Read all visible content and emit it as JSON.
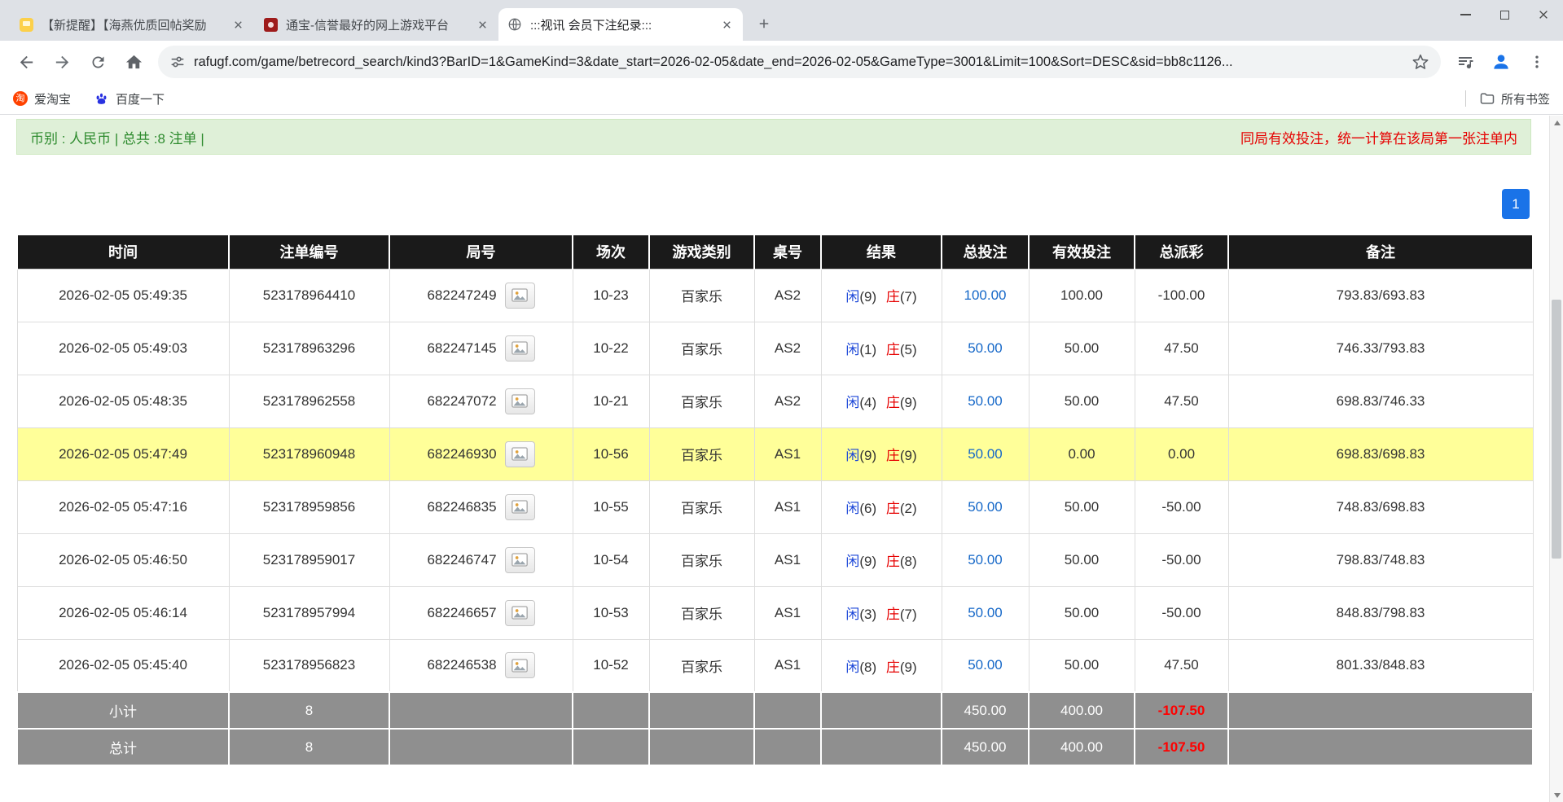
{
  "browser": {
    "tabs": [
      {
        "title": "【新提醒】【海燕优质回帖奖励"
      },
      {
        "title": "通宝-信誉最好的网上游戏平台"
      },
      {
        "title": ":::视讯 会员下注纪录:::"
      }
    ],
    "url": "rafugf.com/game/betrecord_search/kind3?BarID=1&GameKind=3&date_start=2026-02-05&date_end=2026-02-05&GameType=3001&Limit=100&Sort=DESC&sid=bb8c1126...",
    "bookmarks": [
      {
        "label": "爱淘宝"
      },
      {
        "label": "百度一下"
      }
    ],
    "all_bookmarks_label": "所有书签"
  },
  "page": {
    "summary_text": "币别 : 人民币 | 总共 :8 注单 |",
    "notice_text": "同局有效投注，统一计算在该局第一张注单内",
    "pagination": {
      "current": "1"
    }
  },
  "table": {
    "headers": [
      "时间",
      "注单编号",
      "局号",
      "场次",
      "游戏类别",
      "桌号",
      "结果",
      "总投注",
      "有效投注",
      "总派彩",
      "备注"
    ],
    "rows": [
      {
        "time": "2026-02-05 05:49:35",
        "bet_id": "523178964410",
        "round": "682247249",
        "session": "10-23",
        "game": "百家乐",
        "table_no": "AS2",
        "player": "闲(9)",
        "banker": "庄(7)",
        "total_bet": "100.00",
        "valid_bet": "100.00",
        "payout": "-100.00",
        "note": "793.83/693.83",
        "highlight": false
      },
      {
        "time": "2026-02-05 05:49:03",
        "bet_id": "523178963296",
        "round": "682247145",
        "session": "10-22",
        "game": "百家乐",
        "table_no": "AS2",
        "player": "闲(1)",
        "banker": "庄(5)",
        "total_bet": "50.00",
        "valid_bet": "50.00",
        "payout": "47.50",
        "note": "746.33/793.83",
        "highlight": false
      },
      {
        "time": "2026-02-05 05:48:35",
        "bet_id": "523178962558",
        "round": "682247072",
        "session": "10-21",
        "game": "百家乐",
        "table_no": "AS2",
        "player": "闲(4)",
        "banker": "庄(9)",
        "total_bet": "50.00",
        "valid_bet": "50.00",
        "payout": "47.50",
        "note": "698.83/746.33",
        "highlight": false
      },
      {
        "time": "2026-02-05 05:47:49",
        "bet_id": "523178960948",
        "round": "682246930",
        "session": "10-56",
        "game": "百家乐",
        "table_no": "AS1",
        "player": "闲(9)",
        "banker": "庄(9)",
        "total_bet": "50.00",
        "valid_bet": "0.00",
        "payout": "0.00",
        "note": "698.83/698.83",
        "highlight": true
      },
      {
        "time": "2026-02-05 05:47:16",
        "bet_id": "523178959856",
        "round": "682246835",
        "session": "10-55",
        "game": "百家乐",
        "table_no": "AS1",
        "player": "闲(6)",
        "banker": "庄(2)",
        "total_bet": "50.00",
        "valid_bet": "50.00",
        "payout": "-50.00",
        "note": "748.83/698.83",
        "highlight": false
      },
      {
        "time": "2026-02-05 05:46:50",
        "bet_id": "523178959017",
        "round": "682246747",
        "session": "10-54",
        "game": "百家乐",
        "table_no": "AS1",
        "player": "闲(9)",
        "banker": "庄(8)",
        "total_bet": "50.00",
        "valid_bet": "50.00",
        "payout": "-50.00",
        "note": "798.83/748.83",
        "highlight": false
      },
      {
        "time": "2026-02-05 05:46:14",
        "bet_id": "523178957994",
        "round": "682246657",
        "session": "10-53",
        "game": "百家乐",
        "table_no": "AS1",
        "player": "闲(3)",
        "banker": "庄(7)",
        "total_bet": "50.00",
        "valid_bet": "50.00",
        "payout": "-50.00",
        "note": "848.83/798.83",
        "highlight": false
      },
      {
        "time": "2026-02-05 05:45:40",
        "bet_id": "523178956823",
        "round": "682246538",
        "session": "10-52",
        "game": "百家乐",
        "table_no": "AS1",
        "player": "闲(8)",
        "banker": "庄(9)",
        "total_bet": "50.00",
        "valid_bet": "50.00",
        "payout": "47.50",
        "note": "801.33/848.83",
        "highlight": false
      }
    ],
    "subtotal": {
      "label": "小计",
      "count": "8",
      "total_bet": "450.00",
      "valid_bet": "400.00",
      "payout": "-107.50"
    },
    "total": {
      "label": "总计",
      "count": "8",
      "total_bet": "450.00",
      "valid_bet": "400.00",
      "payout": "-107.50"
    }
  },
  "colors": {
    "accent_blue": "#1a73e8",
    "link_blue": "#1668c8",
    "player_blue": "#1b46d8",
    "banker_red": "#e60000",
    "negative_red": "#e80000",
    "highlight_yellow": "#ffff99",
    "header_black": "#1a1a1a",
    "footer_gray": "#8f8f8f",
    "summary_green": "#2e8b2e",
    "summary_bg_green": "#dff0d8"
  }
}
